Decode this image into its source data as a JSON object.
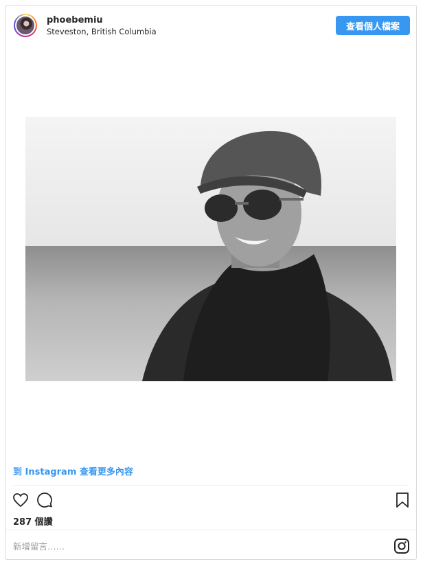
{
  "header": {
    "username": "phoebemiu",
    "location": "Steveston, British Columbia",
    "profile_button": "查看個人檔案"
  },
  "post": {
    "photo_alt": "",
    "more_link": "到 Instagram 查看更多內容",
    "likes": "287 個讚"
  },
  "comment": {
    "placeholder": "新增留言……"
  },
  "icons": {
    "like": "heart-icon",
    "comment": "comment-icon",
    "save": "bookmark-icon",
    "brand": "instagram-icon"
  },
  "colors": {
    "accent": "#3897f0",
    "text": "#262626",
    "border": "#dbdbdb"
  }
}
